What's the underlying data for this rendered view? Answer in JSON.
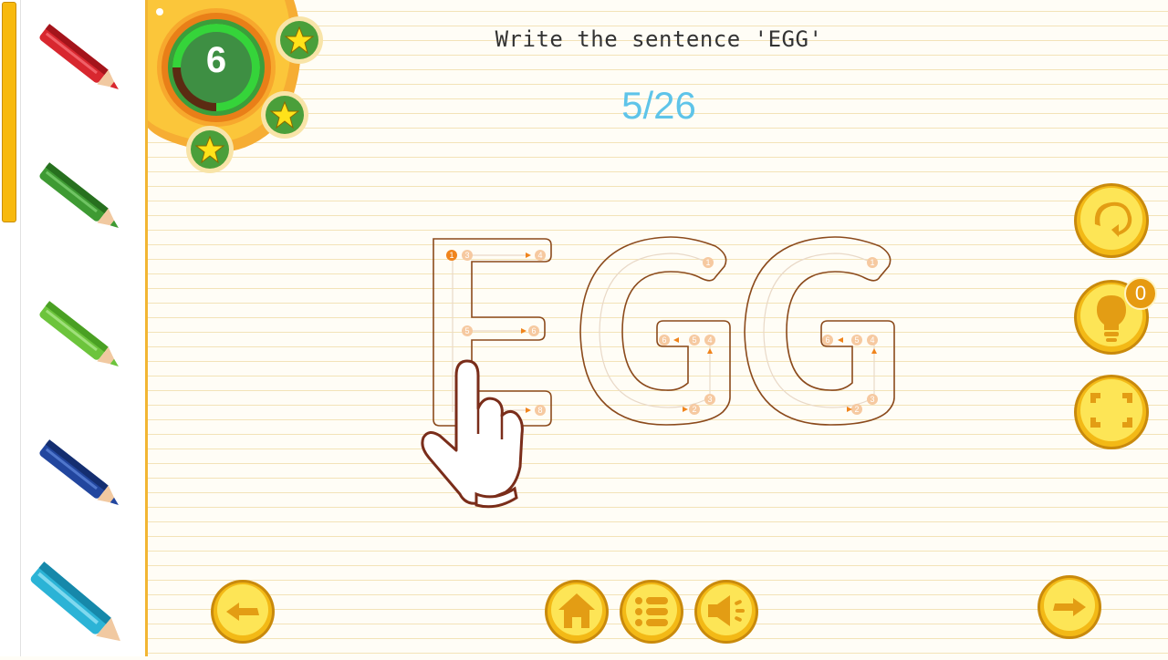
{
  "level": {
    "number": "6",
    "stars_earned": 3
  },
  "instruction": "Write the sentence 'EGG'",
  "progress": "5/26",
  "tracing_word": "EGG",
  "hint": {
    "count": "0"
  },
  "pencils": [
    {
      "name": "red",
      "color": "#d8272f"
    },
    {
      "name": "dark-green",
      "color": "#3e9a33"
    },
    {
      "name": "light-green",
      "color": "#6cc43c"
    },
    {
      "name": "blue",
      "color": "#22469e"
    },
    {
      "name": "cyan",
      "color": "#2bb3d6"
    }
  ],
  "colors": {
    "gold": "#f8c517",
    "guide_stroke": "#8b4a1c",
    "guide_marker": "#f3a53a",
    "progress_text": "#5ec4e9",
    "level_ring": "#2ed12e"
  },
  "icons": {
    "replay": "replay-icon",
    "hint": "lightbulb-icon",
    "fullscreen": "fullscreen-icon",
    "previous": "previous-arrow-icon",
    "home": "home-icon",
    "menu": "list-icon",
    "sound": "speaker-icon",
    "next": "next-arrow-icon"
  }
}
